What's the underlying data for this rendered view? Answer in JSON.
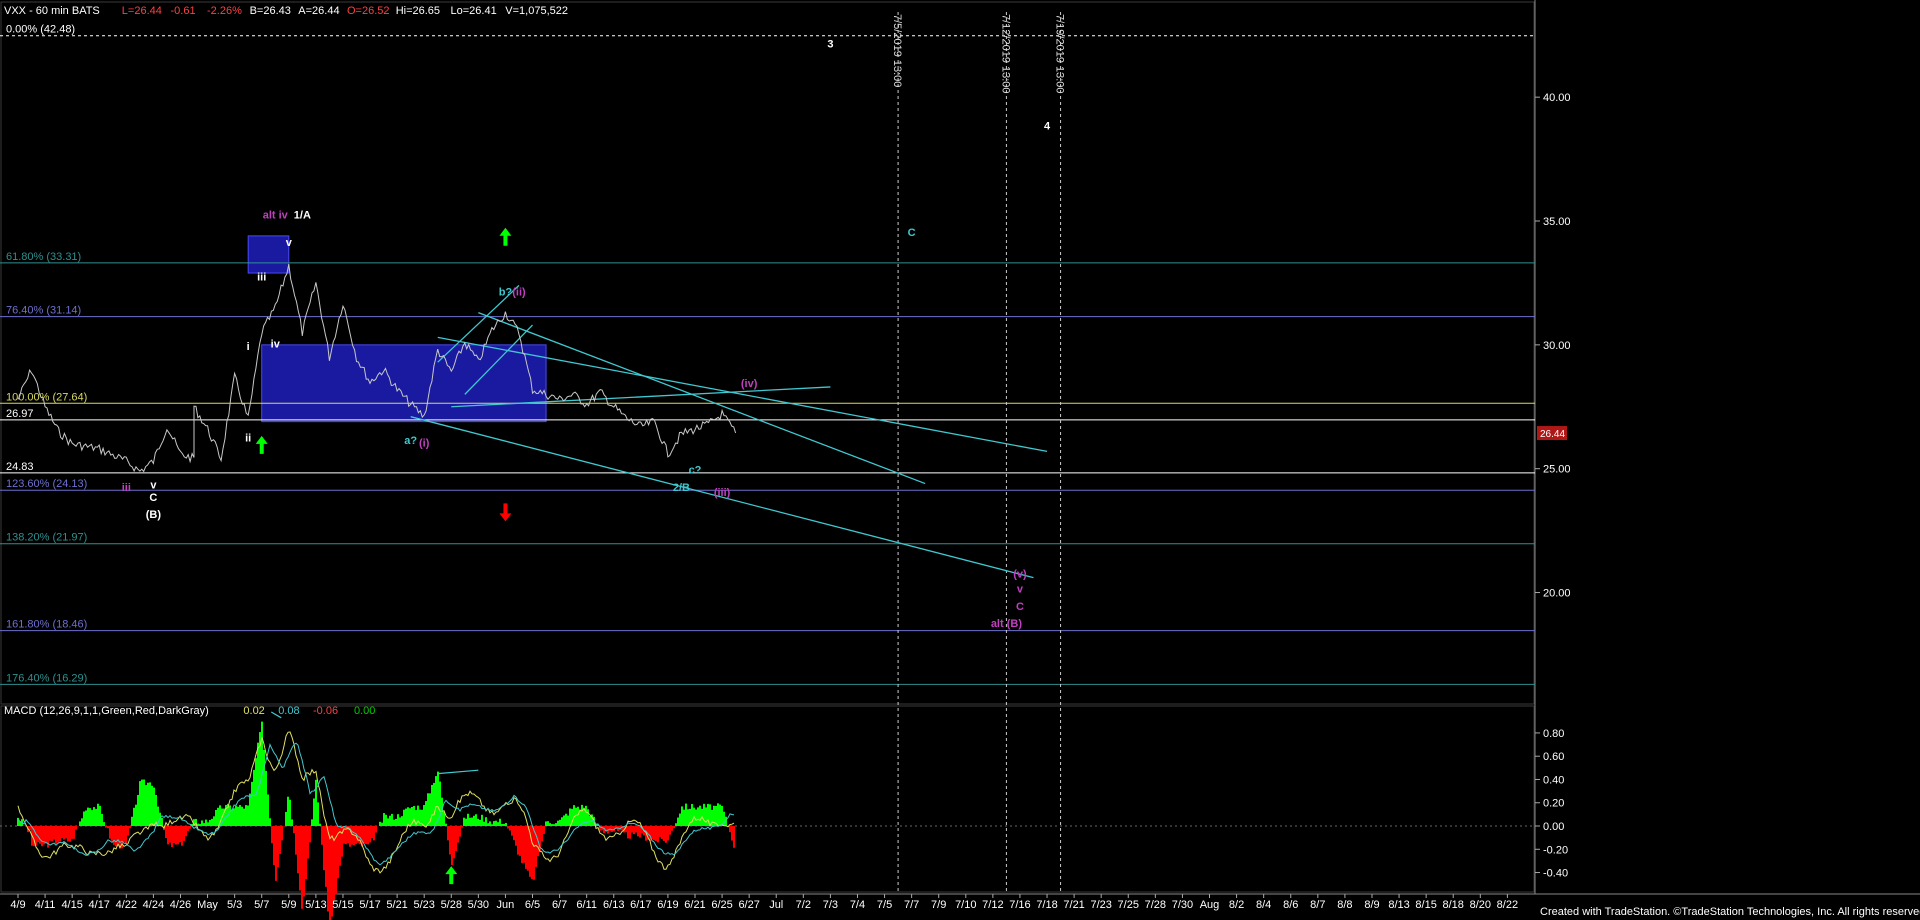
{
  "header": {
    "symbol_line": "VXX - 60 min  BATS",
    "stats": [
      {
        "text": "L=26.44",
        "color": "#ff4040"
      },
      {
        "text": "-0.61",
        "color": "#ff4040"
      },
      {
        "text": "-2.26%",
        "color": "#ff4040"
      },
      {
        "text": "B=26.43",
        "color": "#ffffff"
      },
      {
        "text": "A=26.44",
        "color": "#ffffff"
      },
      {
        "text": "O=26.52",
        "color": "#ff4040"
      },
      {
        "text": "Hi=26.65",
        "color": "#ffffff"
      },
      {
        "text": "Lo=26.41",
        "color": "#ffffff"
      },
      {
        "text": "V=1,075,522",
        "color": "#ffffff"
      }
    ]
  },
  "footer": {
    "credit": "Created with TradeStation. ©TradeStation Technologies, Inc. All rights reserved."
  },
  "colors": {
    "background": "#000000",
    "up": "#00ff00",
    "down": "#ff0000",
    "price_bar": "#c8c8c8",
    "cyan": "#40c8d0",
    "magenta": "#c040c0",
    "white": "#ffffff",
    "box": "#1a1aa0"
  },
  "chart_data": [
    {
      "type": "line",
      "title": "VXX - 60 min  BATS",
      "y_axis": {
        "ticks": [
          "40.00",
          "35.00",
          "30.00",
          "25.00",
          "20.00"
        ],
        "tick_values": [
          40,
          35,
          30,
          25,
          20
        ],
        "range": [
          15.5,
          43.6
        ]
      },
      "x_axis_labels": [
        "4/9",
        "4/11",
        "4/15",
        "4/17",
        "4/22",
        "4/24",
        "4/26",
        "May",
        "5/3",
        "5/7",
        "5/9",
        "5/13",
        "5/15",
        "5/17",
        "5/21",
        "5/23",
        "5/28",
        "5/30",
        "Jun",
        "6/5",
        "6/7",
        "6/11",
        "6/13",
        "6/17",
        "6/19",
        "6/21",
        "6/25",
        "6/27",
        "Jul",
        "7/2",
        "7/3",
        "7/4",
        "7/5",
        "7/7",
        "7/9",
        "7/10",
        "7/12",
        "7/16",
        "7/18",
        "7/21",
        "7/23",
        "7/25",
        "7/28",
        "7/30",
        "Aug",
        "8/2",
        "8/4",
        "8/6",
        "8/7",
        "8/8",
        "8/9",
        "8/13",
        "8/15",
        "8/18",
        "8/20",
        "8/22"
      ],
      "last_price": "26.44",
      "price_path": [
        [
          "4/9",
          27.8
        ],
        [
          "4/10",
          29.0
        ],
        [
          "4/11",
          27.5
        ],
        [
          "4/12",
          26.5
        ],
        [
          "4/15",
          26.0
        ],
        [
          "4/17",
          25.8
        ],
        [
          "4/22",
          25.3
        ],
        [
          "4/23",
          24.9
        ],
        [
          "4/24",
          25.3
        ],
        [
          "4/25",
          26.7
        ],
        [
          "4/26",
          25.6
        ],
        [
          "4/29",
          25.4
        ],
        [
          "4/30",
          27.5
        ],
        [
          "May",
          26.6
        ],
        [
          "5/2",
          25.4
        ],
        [
          "5/3",
          28.7
        ],
        [
          "5/6",
          27.0
        ],
        [
          "5/7",
          30.5
        ],
        [
          "5/8",
          31.5
        ],
        [
          "5/9",
          33.2
        ],
        [
          "5/10",
          30.5
        ],
        [
          "5/13",
          32.5
        ],
        [
          "5/14",
          29.5
        ],
        [
          "5/15",
          31.7
        ],
        [
          "5/16",
          29.5
        ],
        [
          "5/17",
          28.5
        ],
        [
          "5/20",
          29.0
        ],
        [
          "5/21",
          28.2
        ],
        [
          "5/22",
          27.6
        ],
        [
          "5/23",
          27.1
        ],
        [
          "5/24",
          29.8
        ],
        [
          "5/28",
          28.9
        ],
        [
          "5/29",
          30.1
        ],
        [
          "5/30",
          29.3
        ],
        [
          "5/31",
          30.6
        ],
        [
          "Jun",
          31.3
        ],
        [
          "6/4",
          30.5
        ],
        [
          "6/5",
          28.2
        ],
        [
          "6/6",
          28.0
        ],
        [
          "6/7",
          27.8
        ],
        [
          "6/10",
          28.0
        ],
        [
          "6/11",
          27.6
        ],
        [
          "6/12",
          28.1
        ],
        [
          "6/13",
          27.5
        ],
        [
          "6/14",
          27.0
        ],
        [
          "6/17",
          26.7
        ],
        [
          "6/18",
          26.9
        ],
        [
          "6/19",
          25.6
        ],
        [
          "6/20",
          26.4
        ],
        [
          "6/21",
          26.6
        ],
        [
          "6/24",
          26.8
        ],
        [
          "6/25",
          27.2
        ],
        [
          "6/26",
          26.44
        ]
      ],
      "fibonacci_levels": [
        {
          "label": "0.00% (42.48)",
          "value": 42.48,
          "color": "#ffffff"
        },
        {
          "label": "61.80% (33.31)",
          "value": 33.31,
          "color": "#2f8f8f"
        },
        {
          "label": "76.40% (31.14)",
          "value": 31.14,
          "color": "#6f6fd0"
        },
        {
          "label": "100.00% (27.64)",
          "value": 27.64,
          "color": "#d8d860"
        },
        {
          "label": "26.97",
          "value": 26.97,
          "color": "#ffffff"
        },
        {
          "label": "24.83",
          "value": 24.83,
          "color": "#ffffff"
        },
        {
          "label": "123.60% (24.13)",
          "value": 24.13,
          "color": "#6f6fd0"
        },
        {
          "label": "138.20% (21.97)",
          "value": 21.97,
          "color": "#2f8f8f"
        },
        {
          "label": "161.80% (18.46)",
          "value": 18.46,
          "color": "#6f6fd0"
        },
        {
          "label": "176.40% (16.29)",
          "value": 16.29,
          "color": "#2f8f8f"
        }
      ],
      "time_markers": [
        {
          "label": "7/5/2019 13:00",
          "x": "7/6"
        },
        {
          "label": "7/12/2019 13:00",
          "x": "7/14"
        },
        {
          "label": "7/19/2019 13:00",
          "x": "7/20"
        }
      ],
      "zones": [
        {
          "from": "5/6",
          "to": "5/9",
          "low": 32.9,
          "high": 34.4
        },
        {
          "from": "5/7",
          "to": "6/6",
          "low": 26.9,
          "high": 30.0
        }
      ],
      "trendlines": [
        {
          "from": [
            "5/26",
            30.3
          ],
          "to": [
            "7/18",
            25.7
          ]
        },
        {
          "from": [
            "5/28",
            27.5
          ],
          "to": [
            "7/3",
            28.3
          ]
        },
        {
          "from": [
            "5/22",
            27.1
          ],
          "to": [
            "7/17",
            20.6
          ]
        },
        {
          "from": [
            "5/30",
            31.3
          ],
          "to": [
            "7/8",
            24.4
          ]
        },
        {
          "from": [
            "5/26",
            29.3
          ],
          "to": [
            "6/3",
            32.4
          ]
        },
        {
          "from": [
            "5/29",
            28.0
          ],
          "to": [
            "6/5",
            30.8
          ]
        }
      ],
      "wave_labels": [
        {
          "text": "iii",
          "x": "4/22",
          "value": 24.1,
          "color": "#c040c0"
        },
        {
          "text": "v",
          "x": "4/24",
          "value": 24.2,
          "color": "#ffffff"
        },
        {
          "text": "C",
          "x": "4/24",
          "value": 23.7,
          "color": "#ffffff"
        },
        {
          "text": "(B)",
          "x": "4/24",
          "value": 23.0,
          "color": "#ffffff"
        },
        {
          "text": "i",
          "x": "5/6",
          "value": 29.8,
          "color": "#ffffff"
        },
        {
          "text": "ii",
          "x": "5/6",
          "value": 26.1,
          "color": "#ffffff"
        },
        {
          "text": "iii",
          "x": "5/7",
          "value": 32.6,
          "color": "#ffffff"
        },
        {
          "text": "iv",
          "x": "5/8",
          "value": 29.9,
          "color": "#ffffff"
        },
        {
          "text": "alt iv",
          "x": "5/8",
          "value": 35.1,
          "color": "#c040c0"
        },
        {
          "text": "1/A",
          "x": "5/10",
          "value": 35.1,
          "color": "#ffffff"
        },
        {
          "text": "v",
          "x": "5/9",
          "value": 34.0,
          "color": "#ffffff"
        },
        {
          "text": "a?",
          "x": "5/22",
          "value": 26.0,
          "color": "#40c8d0"
        },
        {
          "text": "(i)",
          "x": "5/23",
          "value": 25.9,
          "color": "#c040c0"
        },
        {
          "text": "b?",
          "x": "Jun",
          "value": 32.0,
          "color": "#40c8d0"
        },
        {
          "text": "(ii)",
          "x": "6/3",
          "value": 32.0,
          "color": "#c040c0"
        },
        {
          "text": "(iv)",
          "x": "6/27",
          "value": 28.3,
          "color": "#c040c0"
        },
        {
          "text": "c?",
          "x": "6/21",
          "value": 24.8,
          "color": "#40c8d0"
        },
        {
          "text": "2/B",
          "x": "6/20",
          "value": 24.1,
          "color": "#40c8d0"
        },
        {
          "text": "(iii)",
          "x": "6/25",
          "value": 23.9,
          "color": "#c040c0"
        },
        {
          "text": "3",
          "x": "7/3",
          "value": 42.0,
          "color": "#ffffff"
        },
        {
          "text": "4",
          "x": "7/18",
          "value": 38.7,
          "color": "#ffffff"
        },
        {
          "text": "C",
          "x": "7/7",
          "value": 34.4,
          "color": "#40c8d0"
        },
        {
          "text": "(v)",
          "x": "7/16",
          "value": 20.6,
          "color": "#c040c0"
        },
        {
          "text": "v",
          "x": "7/16",
          "value": 20.0,
          "color": "#c040c0"
        },
        {
          "text": "C",
          "x": "7/16",
          "value": 19.3,
          "color": "#c040c0"
        },
        {
          "text": "alt (B)",
          "x": "7/15",
          "value": 18.6,
          "color": "#c040c0"
        }
      ],
      "arrows": [
        {
          "direction": "up",
          "x": "5/7",
          "value": 25.6,
          "color": "#00ff00"
        },
        {
          "direction": "up",
          "x": "Jun",
          "value": 34.0,
          "color": "#00ff00"
        },
        {
          "direction": "down",
          "x": "Jun",
          "value": 23.6,
          "color": "#ff0000"
        }
      ]
    },
    {
      "type": "area",
      "title": "MACD (12,26,9,1,1,Green,Red,DarkGray)",
      "legend": [
        {
          "text": "MACD (12,26,9,1,1,Green,Red,DarkGray)",
          "color": "#ffffff"
        },
        {
          "text": "0.02",
          "color": "#e0e060"
        },
        {
          "text": "0.08",
          "color": "#40c8d0"
        },
        {
          "text": "-0.06",
          "color": "#ff4040"
        },
        {
          "text": "0.00",
          "color": "#00cc00"
        }
      ],
      "y_axis": {
        "ticks": [
          "0.80",
          "0.60",
          "0.40",
          "0.20",
          "0.00",
          "-0.20",
          "-0.40"
        ],
        "tick_values": [
          0.8,
          0.6,
          0.4,
          0.2,
          0.0,
          -0.2,
          -0.4
        ],
        "range": [
          -0.55,
          0.98
        ]
      },
      "macd_path": [
        [
          "4/9",
          0.05
        ],
        [
          "4/11",
          -0.15
        ],
        [
          "4/15",
          -0.3
        ],
        [
          "4/17",
          -0.1
        ],
        [
          "4/22",
          -0.3
        ],
        [
          "4/24",
          0.15
        ],
        [
          "4/26",
          -0.05
        ],
        [
          "May",
          0.0
        ],
        [
          "5/3",
          0.2
        ],
        [
          "5/6",
          0.3
        ],
        [
          "5/7",
          0.85
        ],
        [
          "5/8",
          0.55
        ],
        [
          "5/9",
          0.75
        ],
        [
          "5/10",
          0.3
        ],
        [
          "5/13",
          0.55
        ],
        [
          "5/14",
          0.0
        ],
        [
          "5/15",
          -0.1
        ],
        [
          "5/17",
          -0.3
        ],
        [
          "5/21",
          -0.2
        ],
        [
          "5/23",
          0.0
        ],
        [
          "5/24",
          0.3
        ],
        [
          "5/28",
          0.1
        ],
        [
          "5/30",
          0.2
        ],
        [
          "Jun",
          0.25
        ],
        [
          "6/4",
          0.1
        ],
        [
          "6/5",
          -0.2
        ],
        [
          "6/7",
          -0.15
        ],
        [
          "6/11",
          0.05
        ],
        [
          "6/13",
          0.0
        ],
        [
          "6/17",
          -0.1
        ],
        [
          "6/19",
          -0.25
        ],
        [
          "6/21",
          -0.05
        ],
        [
          "6/24",
          0.05
        ],
        [
          "6/25",
          0.15
        ],
        [
          "6/26",
          0.02
        ]
      ],
      "arrows": [
        {
          "direction": "up",
          "x": "5/28",
          "value": -0.5,
          "color": "#00ff00"
        }
      ]
    }
  ]
}
